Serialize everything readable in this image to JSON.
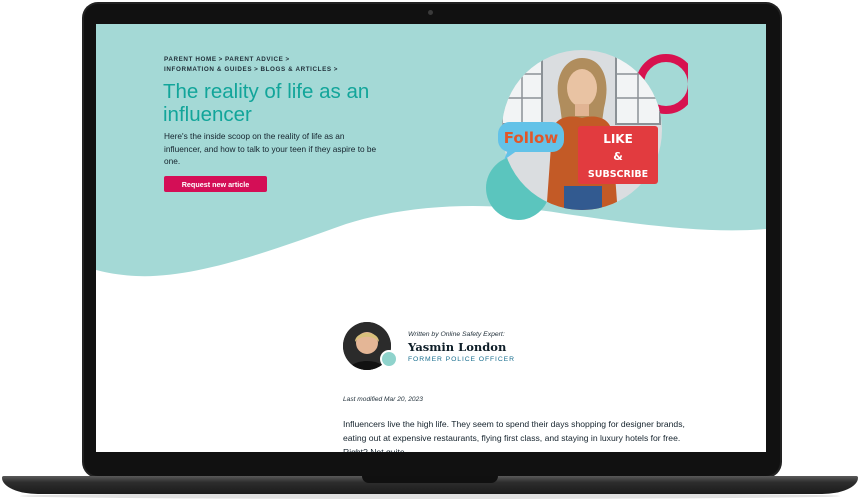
{
  "breadcrumb": {
    "items": [
      "Parent home",
      "Parent advice",
      "Information & guides",
      "Blogs & articles"
    ],
    "separator": ">"
  },
  "hero": {
    "title": "The reality of life as an influencer",
    "intro": "Here's the inside scoop on the reality of life as an influencer, and how to talk to your teen if they aspire to be one.",
    "button_label": "Request new article",
    "sign_follow": "Follow",
    "sign_like": "LIKE",
    "sign_and": "&",
    "sign_subscribe": "SUBSCRIBE"
  },
  "author": {
    "written_by": "Written by Online Safety Expert:",
    "name": "Yasmin London",
    "role": "Former Police Officer"
  },
  "article": {
    "last_modified": "Last modified Mar 20, 2023",
    "first_paragraph": "Influencers live the high life. They seem to spend their days shopping for designer brands, eating out at expensive restaurants, flying first class, and staying in luxury hotels for free. Right? Not quite."
  },
  "colors": {
    "hero_bg": "#a4d9d6",
    "title": "#12a59a",
    "button": "#d40e56",
    "ring": "#d7124f",
    "teal_circle": "#5bc5be"
  }
}
